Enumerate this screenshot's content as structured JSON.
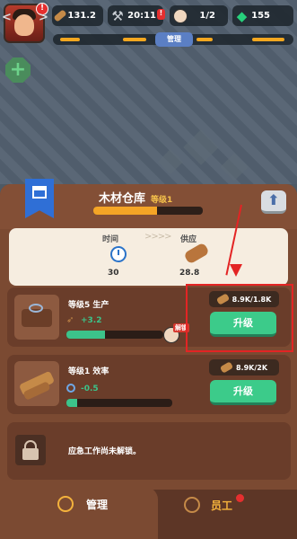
{
  "hud": {
    "avatar_badge": "!",
    "prev_arrow": "<",
    "next_arrow": ">",
    "wood": "131.2",
    "time": "20:11",
    "time_badge": "!",
    "workers": "1/2",
    "gems": "155",
    "manager_tag": "管理"
  },
  "building": {
    "title": "木材仓库",
    "level_tag": "等级1"
  },
  "stats": {
    "time_label": "时间",
    "supply_label": "供应",
    "arrows": ">>>>",
    "time_value": "30",
    "supply_value": "28.8"
  },
  "cards": [
    {
      "title": "等级5 生产",
      "bonus": "+3.2",
      "progress_fraction": 0.4,
      "resource": "8.9K/1.8K",
      "button": "升级",
      "badge": "解锁"
    },
    {
      "title": "等级1 效率",
      "bonus": "-0.5",
      "progress_fraction": 0.1,
      "resource": "8.9K/2K",
      "button": "升级"
    }
  ],
  "locked": {
    "text": "应急工作尚未解锁。"
  },
  "tabs": {
    "manage": "管理",
    "staff": "员工"
  },
  "colors": {
    "accent_green": "#3ccb8a",
    "accent_orange": "#f5a526",
    "panel_brown": "#7b4a32",
    "highlight_red": "#e32424"
  }
}
